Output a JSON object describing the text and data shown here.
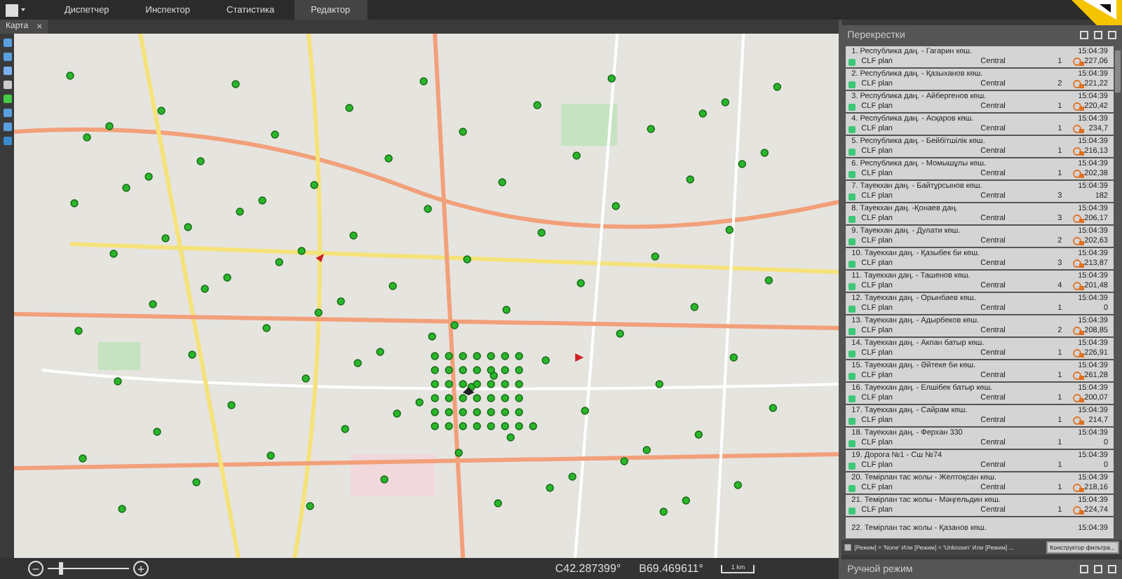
{
  "menu": [
    {
      "label": "Диспетчер",
      "selected": false
    },
    {
      "label": "Инспектор",
      "selected": false
    },
    {
      "label": "Статистика",
      "selected": false
    },
    {
      "label": "Редактор",
      "selected": true
    }
  ],
  "doc_tab": {
    "label": "Карта",
    "close": "×"
  },
  "map": {
    "zoom": {
      "minus": "−",
      "plus": "+",
      "level": 0.15
    },
    "lat": "С42.287399°",
    "lon": "В69.469611°",
    "scale": "1 km"
  },
  "panel": {
    "title": "Перекрестки",
    "rows": [
      {
        "title": "1. Республика даң. - Гагарин көш.",
        "time": "15:04:39",
        "mode": "CLF plan",
        "source": "Central",
        "count": "1",
        "value": "227,06",
        "alert": true,
        "color": "#3cc878"
      },
      {
        "title": "2. Республика даң. - Қазыханов көш.",
        "time": "15:04:39",
        "mode": "CLF plan",
        "source": "Central",
        "count": "2",
        "value": "221,22",
        "alert": true,
        "color": "#3cc878"
      },
      {
        "title": "3. Республика даң. - Айбергенов көш.",
        "time": "15:04:39",
        "mode": "CLF plan",
        "source": "Central",
        "count": "1",
        "value": "220,42",
        "alert": true,
        "color": "#3cc878"
      },
      {
        "title": "4. Республика даң. - Асқаров көш.",
        "time": "15:04:39",
        "mode": "CLF plan",
        "source": "Central",
        "count": "1",
        "value": "234,7",
        "alert": true,
        "color": "#3cc878"
      },
      {
        "title": "5. Республика даң. - Бейбітшілік көш.",
        "time": "15:04:39",
        "mode": "CLF plan",
        "source": "Central",
        "count": "1",
        "value": "216,13",
        "alert": true,
        "color": "#3cc878"
      },
      {
        "title": "6. Республика даң. - Момышұлы көш.",
        "time": "15:04:39",
        "mode": "CLF plan",
        "source": "Central",
        "count": "1",
        "value": "202,38",
        "alert": true,
        "color": "#3cc878"
      },
      {
        "title": "7. Тауекхан даң. - Байтұрсынов көш.",
        "time": "15:04:39",
        "mode": "CLF plan",
        "source": "Central",
        "count": "3",
        "value": "182",
        "alert": false,
        "color": "#3cc878"
      },
      {
        "title": "8. Тауекхан даң. -Қонаев даң.",
        "time": "15:04:39",
        "mode": "CLF plan",
        "source": "Central",
        "count": "3",
        "value": "206,17",
        "alert": true,
        "color": "#3cc878"
      },
      {
        "title": "9. Тауекхан даң. - Дулати көш.",
        "time": "15:04:39",
        "mode": "CLF plan",
        "source": "Central",
        "count": "2",
        "value": "202,63",
        "alert": true,
        "color": "#3cc878"
      },
      {
        "title": "10. Тауекхан даң. - Қазыбек би көш.",
        "time": "15:04:39",
        "mode": "CLF plan",
        "source": "Central",
        "count": "3",
        "value": "213,87",
        "alert": true,
        "color": "#3cc878"
      },
      {
        "title": "11. Тауекхан даң. - Ташенов көш.",
        "time": "15:04:39",
        "mode": "CLF plan",
        "source": "Central",
        "count": "4",
        "value": "201,48",
        "alert": true,
        "color": "#3cc878"
      },
      {
        "title": "12. Тауекхан даң. - Орынбаев көш.",
        "time": "15:04:39",
        "mode": "CLF plan",
        "source": "Central",
        "count": "1",
        "value": "0",
        "alert": false,
        "color": "#3cc878"
      },
      {
        "title": "13. Тауекхан даң. - Адырбеков көш.",
        "time": "15:04:39",
        "mode": "CLF plan",
        "source": "Central",
        "count": "2",
        "value": "208,85",
        "alert": true,
        "color": "#3cc878"
      },
      {
        "title": "14. Тауекхан даң. - Акпан батыр көш.",
        "time": "15:04:39",
        "mode": "CLF plan",
        "source": "Central",
        "count": "1",
        "value": "226,91",
        "alert": true,
        "color": "#3cc878"
      },
      {
        "title": "15. Тауекхан даң. - Әйтеке би көш.",
        "time": "15:04:39",
        "mode": "CLF plan",
        "source": "Central",
        "count": "1",
        "value": "261,28",
        "alert": true,
        "color": "#3cc878"
      },
      {
        "title": "16. Тауекхан даң. - Елшібек батыр көш.",
        "time": "15:04:39",
        "mode": "CLF plan",
        "source": "Central",
        "count": "1",
        "value": "200,07",
        "alert": true,
        "color": "#3cc878"
      },
      {
        "title": "17. Тауекхан даң. - Сайрам көш.",
        "time": "15:04:39",
        "mode": "CLF plan",
        "source": "Central",
        "count": "1",
        "value": "214,7",
        "alert": true,
        "color": "#3cc878"
      },
      {
        "title": "18. Тауекхан даң. - Ферхан 330",
        "time": "15:04:39",
        "mode": "CLF plan",
        "source": "Central",
        "count": "1",
        "value": "0",
        "alert": false,
        "color": "#3cc878"
      },
      {
        "title": "19. Дорога №1 - Сш №74",
        "time": "15:04:39",
        "mode": "CLF plan",
        "source": "Central",
        "count": "1",
        "value": "0",
        "alert": false,
        "color": "#3cc878"
      },
      {
        "title": "20. Темірлан тас жолы - Желтоқсан көш.",
        "time": "15:04:39",
        "mode": "CLF plan",
        "source": "Central",
        "count": "1",
        "value": "218,16",
        "alert": true,
        "color": "#3cc878"
      },
      {
        "title": "21. Темірлан тас жолы - Мәңгельдин көш.",
        "time": "15:04:39",
        "mode": "CLF plan",
        "source": "Central",
        "count": "1",
        "value": "224,74",
        "alert": true,
        "color": "#3cc878"
      },
      {
        "title": "22. Темірлан тас жолы - Қазанов көш.",
        "time": "15:04:39"
      }
    ],
    "filter": {
      "checked": false,
      "text": "[Режим] = 'None' Или [Режим] = 'Unknown' Или [Режим] ...",
      "button": "Конструктор фильтра..."
    },
    "bottom_title": "Ручной режим"
  }
}
